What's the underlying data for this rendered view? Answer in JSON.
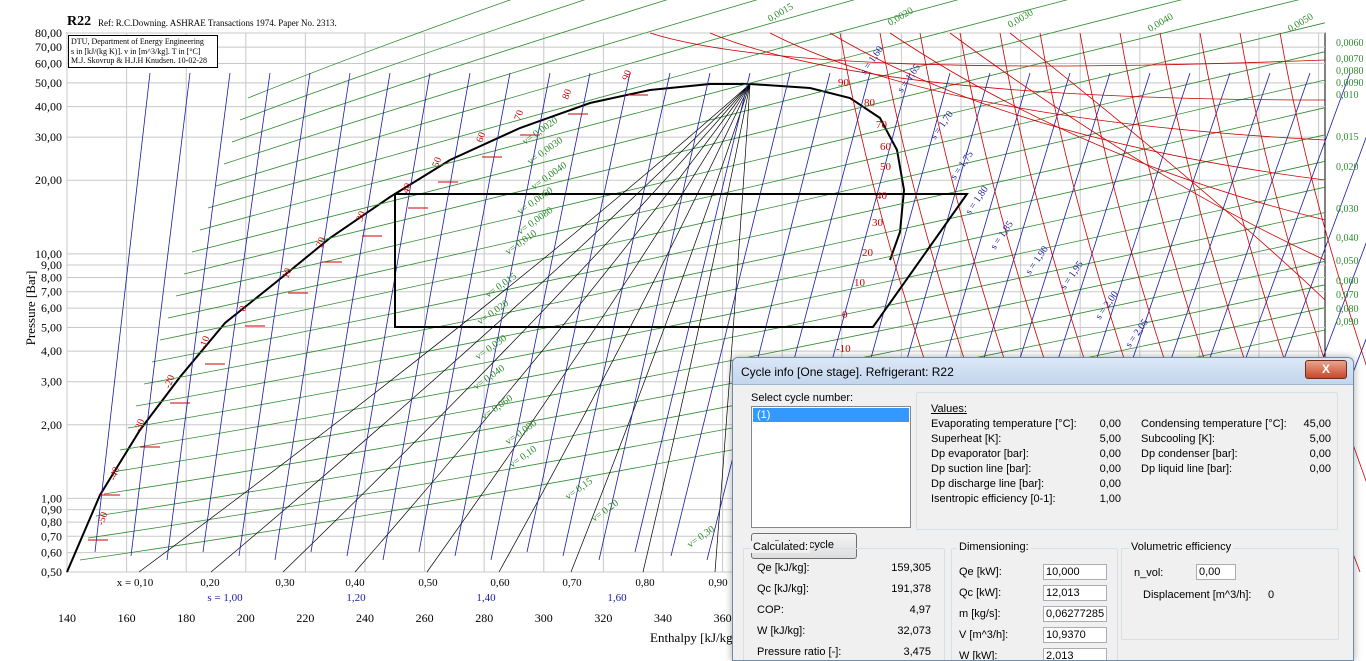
{
  "chart": {
    "title": "R22",
    "reference": "Ref: R.C.Downing. ASHRAE Transactions 1974. Paper No. 2313.",
    "info_lines": [
      "DTU, Department of Energy Engineering",
      "s in [kJ/(kg K)]. v in [m^3/kg]. T in [°C]",
      "M.J. Skovrup & H.J.H Knudsen. 10-02-28"
    ],
    "ylabel": "Pressure [Bar]",
    "xlabel": "Enthalpy [kJ/kg]",
    "pressure_ticks": [
      "80,00",
      "70,00",
      "60,00",
      "50,00",
      "40,00",
      "30,00",
      "20,00",
      "10,00",
      "9,00",
      "8,00",
      "7,00",
      "6,00",
      "5,00",
      "4,00",
      "3,00",
      "2,00",
      "1,00",
      "0,90",
      "0,80",
      "0,70",
      "0,60",
      "0,50"
    ],
    "enthalpy_ticks": [
      "140",
      "160",
      "180",
      "200",
      "220",
      "240",
      "260",
      "280",
      "300",
      "320",
      "340",
      "360"
    ],
    "quality_ticks": [
      "x = 0,10",
      "0,20",
      "0,30",
      "0,40",
      "0,50",
      "0,60",
      "0,70",
      "0,80",
      "0,90"
    ],
    "entropy_ticks": [
      "s = 1,00",
      "1,20",
      "1,40",
      "1,60"
    ],
    "sat_temps": [
      "-50",
      "-40",
      "-30",
      "-20",
      "-10",
      "0",
      "10",
      "20",
      "30",
      "40",
      "50",
      "60",
      "70",
      "80",
      "90"
    ],
    "vapor_temps": [
      "90",
      "80",
      "70",
      "60",
      "50",
      "40",
      "30",
      "20",
      "10",
      "0",
      "-10"
    ],
    "right_volumes": [
      "0,0060",
      "0,0070",
      "0,0080",
      "0,0090",
      "0,010",
      "0,015",
      "0,020",
      "0,030",
      "0,040",
      "0,050",
      "0,060",
      "0,070",
      "0,080",
      "0,090"
    ],
    "top_volumes": [
      "0,0015",
      "0,0020",
      "0,0030",
      "0,0040",
      "0,0050"
    ],
    "inner_volumes": [
      "v= 0,0020",
      "v= 0,0030",
      "v= 0,0040",
      "v= 0,0060",
      "v= 0,0080",
      "v= 0,010",
      "v= 0,015",
      "v= 0,020",
      "v= 0,030",
      "v= 0,040",
      "v= 0,060",
      "v= 0,080",
      "v= 0,10",
      "v= 0,15",
      "v= 0,20",
      "v= 0,30"
    ],
    "entropy_labels": [
      "s = 1,60",
      "s = 1,65",
      "s = 1,70",
      "s = 1,75",
      "s = 1,80",
      "s = 1,85",
      "s = 1,90",
      "s = 1,95",
      "s = 2,00",
      "s = 2,05"
    ],
    "colors": {
      "saturation": "#000000",
      "isotherm": "#cc0000",
      "isochore": "#2e8b2e",
      "isentrope": "#1a1aa6",
      "cycle": "#000000"
    }
  },
  "dialog": {
    "title": "Cycle info [One stage]. Refrigerant: R22",
    "close_label": "X",
    "select_label": "Select cycle number:",
    "cycles": [
      "(1)"
    ],
    "delete_label": "Delete cycle",
    "values_title": "Values:",
    "values_left": [
      {
        "label": "Evaporating temperature [°C]:",
        "value": "0,00"
      },
      {
        "label": "Superheat [K]:",
        "value": "5,00"
      },
      {
        "label": "Dp evaporator [bar]:",
        "value": "0,00"
      },
      {
        "label": "Dp suction line [bar]:",
        "value": "0,00"
      },
      {
        "label": "Dp discharge line [bar]:",
        "value": "0,00"
      },
      {
        "label": "Isentropic efficiency [0-1]:",
        "value": "1,00"
      }
    ],
    "values_right": [
      {
        "label": "Condensing temperature [°C]:",
        "value": "45,00"
      },
      {
        "label": "Subcooling [K]:",
        "value": "5,00"
      },
      {
        "label": "Dp condenser [bar]:",
        "value": "0,00"
      },
      {
        "label": "Dp liquid line [bar]:",
        "value": "0,00"
      }
    ],
    "calculated_title": "Calculated:",
    "calculated": [
      {
        "label": "Qe [kJ/kg]:",
        "value": "159,305"
      },
      {
        "label": "Qc [kJ/kg]:",
        "value": "191,378"
      },
      {
        "label": "COP:",
        "value": "4,97"
      },
      {
        "label": "W [kJ/kg]:",
        "value": "32,073"
      },
      {
        "label": "Pressure ratio [-]:",
        "value": "3,475"
      }
    ],
    "dimensioning_title": "Dimensioning:",
    "dimensioning": [
      {
        "label": "Qe [kW]:",
        "value": "10,000"
      },
      {
        "label": "Qc [kW]:",
        "value": "12,013"
      },
      {
        "label": "m [kg/s]:",
        "value": "0,06277285"
      },
      {
        "label": "V [m^3/h]:",
        "value": "10,9370"
      },
      {
        "label": "W [kW]:",
        "value": "2,013"
      }
    ],
    "volumetric_title": "Volumetric efficiency",
    "nvol_label": "n_vol:",
    "nvol_value": "0,00",
    "displacement_label": "Displacement [m^3/h]:",
    "displacement_value": "0"
  }
}
